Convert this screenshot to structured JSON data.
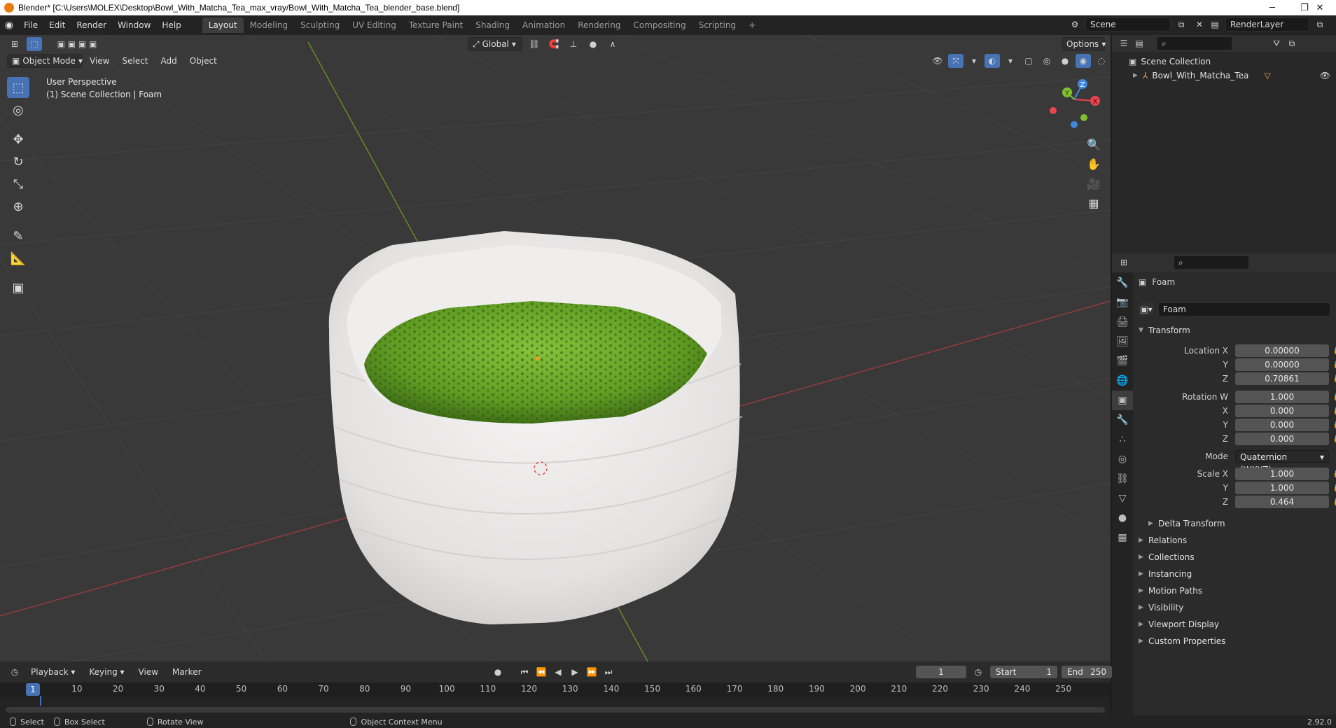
{
  "window": {
    "title": "Blender* [C:\\Users\\MOLEX\\Desktop\\Bowl_With_Matcha_Tea_max_vray/Bowl_With_Matcha_Tea_blender_base.blend]",
    "minimize": "─",
    "restore": "❐",
    "close": "✕"
  },
  "menubar": {
    "items": [
      "File",
      "Edit",
      "Render",
      "Window",
      "Help"
    ],
    "workspaces": [
      "Layout",
      "Modeling",
      "Sculpting",
      "UV Editing",
      "Texture Paint",
      "Shading",
      "Animation",
      "Rendering",
      "Compositing",
      "Scripting"
    ],
    "active_workspace": "Layout",
    "add_workspace": "+",
    "scene": "Scene",
    "render_layer": "RenderLayer"
  },
  "viewport_header": {
    "transform_orientation": "Global",
    "options": "Options",
    "mode": "Object Mode",
    "menus": [
      "View",
      "Select",
      "Add",
      "Object"
    ]
  },
  "viewport": {
    "perspective": "User Perspective",
    "collection_info": "(1) Scene Collection | Foam",
    "gizmo_axes": {
      "x": "X",
      "y": "Y",
      "z": "Z"
    },
    "colors": {
      "background": "#393939",
      "grid": "#444444",
      "x_axis": "#9d3a40",
      "y_axis": "#6b8e23",
      "bowl": "#e9e6e6",
      "matcha": "#6aa82a",
      "gizmo_x": "#e8454f",
      "gizmo_y": "#7fc12b",
      "gizmo_z": "#3f86de"
    }
  },
  "outliner": {
    "root": "Scene Collection",
    "items": [
      {
        "label": "Bowl_With_Matcha_Tea"
      }
    ]
  },
  "properties": {
    "object_name": "Foam",
    "data_name": "Foam",
    "transform_panel": "Transform",
    "location": {
      "label_x": "Location X",
      "label_y": "Y",
      "label_z": "Z",
      "x": "0.00000",
      "y": "0.00000",
      "z": "0.70861"
    },
    "rotation": {
      "label_w": "Rotation W",
      "label_x": "X",
      "label_y": "Y",
      "label_z": "Z",
      "w": "1.000",
      "x": "0.000",
      "y": "0.000",
      "z": "0.000"
    },
    "mode_label": "Mode",
    "mode_value": "Quaternion (WXYZ)",
    "scale": {
      "label_x": "Scale X",
      "label_y": "Y",
      "label_z": "Z",
      "x": "1.000",
      "y": "1.000",
      "z": "0.464"
    },
    "subpanels": [
      "Delta Transform"
    ],
    "panels": [
      "Relations",
      "Collections",
      "Instancing",
      "Motion Paths",
      "Visibility",
      "Viewport Display",
      "Custom Properties"
    ]
  },
  "timeline": {
    "menus": [
      "Playback",
      "Keying",
      "View",
      "Marker"
    ],
    "current_frame": "1",
    "start_label": "Start",
    "start": "1",
    "end_label": "End",
    "end": "250",
    "ticks": [
      "10",
      "20",
      "30",
      "40",
      "50",
      "60",
      "70",
      "80",
      "90",
      "100",
      "110",
      "120",
      "130",
      "140",
      "150",
      "160",
      "170",
      "180",
      "190",
      "200",
      "210",
      "220",
      "230",
      "240",
      "250"
    ],
    "cursor_frame": "1"
  },
  "statusbar": {
    "select": "Select",
    "box_select": "Box Select",
    "rotate_view": "Rotate View",
    "context_menu": "Object Context Menu",
    "version": "2.92.0"
  }
}
